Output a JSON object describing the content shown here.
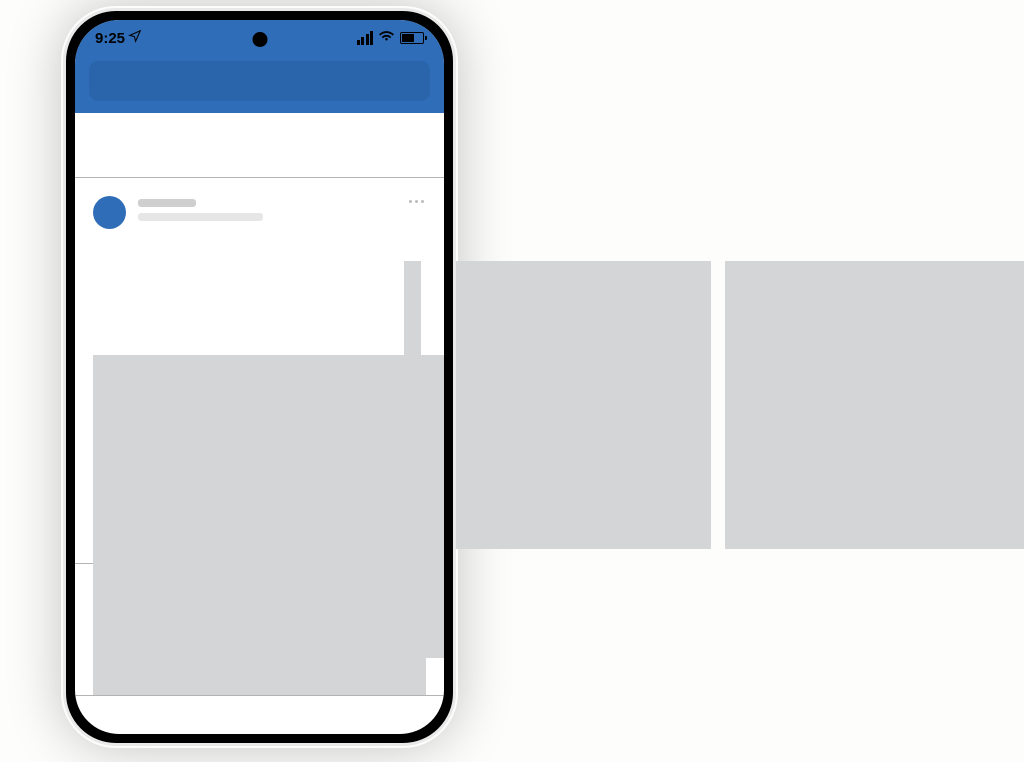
{
  "status": {
    "time": "9:25"
  },
  "carousel": {
    "pane_count": 3
  }
}
